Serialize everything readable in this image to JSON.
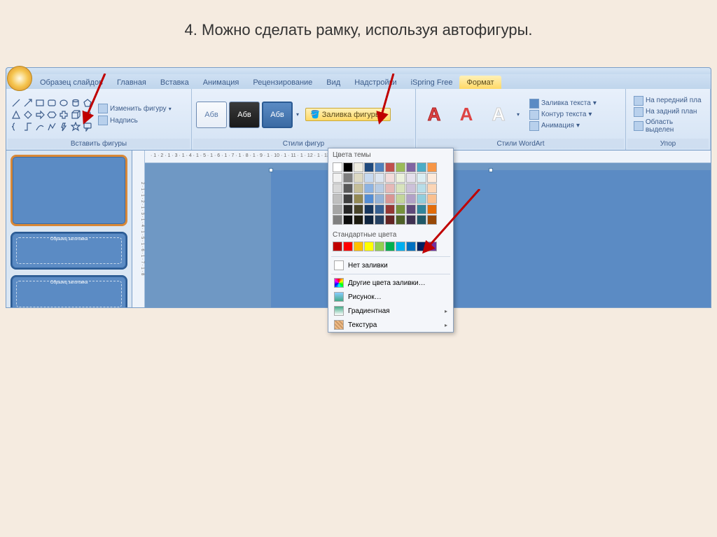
{
  "title": "4. Можно сделать рамку, используя автофигуры.",
  "tabs": [
    "Образец слайдов",
    "Главная",
    "Вставка",
    "Анимация",
    "Рецензирование",
    "Вид",
    "Надстройки",
    "iSpring Free",
    "Формат"
  ],
  "active_tab_index": 8,
  "ribbon": {
    "group_shapes": "Вставить фигуры",
    "change_shape": "Изменить фигуру",
    "text_box": "Надпись",
    "group_styles": "Стили фигур",
    "style_label": "Абв",
    "shape_fill": "Заливка фигуры",
    "group_wordart": "Стили WordArt",
    "wordart_letter": "А",
    "text_fill": "Заливка текста",
    "text_outline": "Контур текста",
    "text_anim": "Анимация",
    "bring_front": "На передний пла",
    "send_back": "На задний план",
    "selection_pane": "Область выделен",
    "group_arrange": "Упор"
  },
  "dropdown": {
    "theme_colors": "Цвета темы",
    "standard_colors": "Стандартные цвета",
    "no_fill": "Нет заливки",
    "more_colors": "Другие цвета заливки…",
    "picture": "Рисунок…",
    "gradient": "Градиентная",
    "texture": "Текстура"
  },
  "theme_palette_top": [
    "#ffffff",
    "#000000",
    "#eeece1",
    "#1f497d",
    "#4f81bd",
    "#c0504d",
    "#9bbb59",
    "#8064a2",
    "#4bacc6",
    "#f79646"
  ],
  "theme_palette_rows": [
    [
      "#f2f2f2",
      "#7f7f7f",
      "#ddd9c3",
      "#c6d9f0",
      "#dbe5f1",
      "#f2dcdb",
      "#ebf1dd",
      "#e5e0ec",
      "#dbeef3",
      "#fdeada"
    ],
    [
      "#d8d8d8",
      "#595959",
      "#c4bd97",
      "#8db3e2",
      "#b8cce4",
      "#e5b9b7",
      "#d7e3bc",
      "#ccc1d9",
      "#b7dde8",
      "#fbd5b5"
    ],
    [
      "#bfbfbf",
      "#3f3f3f",
      "#938953",
      "#548dd4",
      "#95b3d7",
      "#d99694",
      "#c3d69b",
      "#b2a2c7",
      "#92cddc",
      "#fac08f"
    ],
    [
      "#a5a5a5",
      "#262626",
      "#494429",
      "#17365d",
      "#366092",
      "#953734",
      "#76923c",
      "#5f497a",
      "#31859b",
      "#e36c09"
    ],
    [
      "#7f7f7f",
      "#0c0c0c",
      "#1d1b10",
      "#0f243e",
      "#244061",
      "#632423",
      "#4f6128",
      "#3f3151",
      "#205867",
      "#974806"
    ]
  ],
  "standard_palette": [
    "#c00000",
    "#ff0000",
    "#ffc000",
    "#ffff00",
    "#92d050",
    "#00b050",
    "#00b0f0",
    "#0070c0",
    "#002060",
    "#7030a0"
  ],
  "thumb_label": "Образец заголовка",
  "ruler_h": "· 1 · 2 · 1 · 3 · 1 · 4 · 1 · 5 · 1 · 6 · 1 · 7 · 1 · 8 · 1 · 9 · 1 · 10 · 1 · 11 · 1 · 12 · 1 · 13 · 1 · 14 · 1 · 15 · 1 · 16",
  "ruler_v": "2 · 1 · 1 · 2 · 1 · 3 · 1 · 4 · 1 · 5 · 1 · 6 · 1 · 7 · 1 · 8"
}
